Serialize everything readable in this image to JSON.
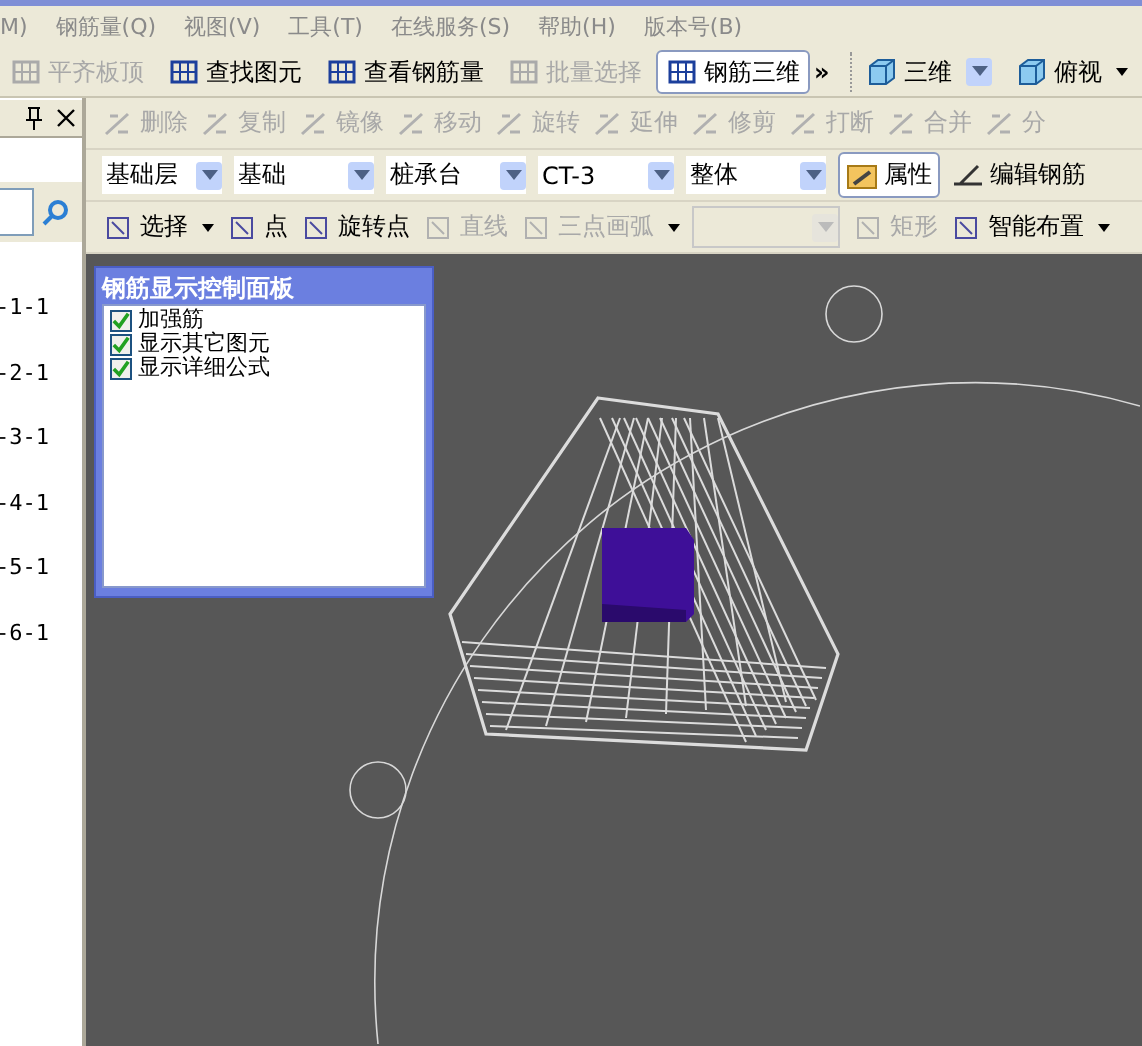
{
  "menu": [
    "M)",
    "钢筋量(Q)",
    "视图(V)",
    "工具(T)",
    "在线服务(S)",
    "帮助(H)",
    "版本号(B)"
  ],
  "main_toolbar": [
    {
      "label": "平齐板顶",
      "disabled": true,
      "selected": false
    },
    {
      "label": "查找图元",
      "disabled": false,
      "selected": false
    },
    {
      "label": "查看钢筋量",
      "disabled": false,
      "selected": false
    },
    {
      "label": "批量选择",
      "disabled": true,
      "selected": false
    },
    {
      "label": "钢筋三维",
      "disabled": false,
      "selected": true
    }
  ],
  "overflow": "»",
  "view_toolbar": [
    {
      "label": "三维",
      "kind": "combo"
    },
    {
      "label": "俯视",
      "kind": "menu"
    }
  ],
  "side_panel": {
    "list": [
      "-1-1",
      "-2-1",
      "-3-1",
      "-4-1",
      "-5-1",
      "-6-1"
    ]
  },
  "edit_toolbar": [
    {
      "label": "删除",
      "disabled": true
    },
    {
      "label": "复制",
      "disabled": true
    },
    {
      "label": "镜像",
      "disabled": true
    },
    {
      "label": "移动",
      "disabled": true
    },
    {
      "label": "旋转",
      "disabled": true
    },
    {
      "label": "延伸",
      "disabled": true
    },
    {
      "label": "修剪",
      "disabled": true
    },
    {
      "label": "打断",
      "disabled": true
    },
    {
      "label": "合并",
      "disabled": true
    },
    {
      "label": "分",
      "disabled": true
    }
  ],
  "selectors": [
    "基础层",
    "基础",
    "桩承台",
    "CT-3",
    "整体"
  ],
  "property_button": {
    "label": "属性",
    "selected": true
  },
  "edit_rebar": "编辑钢筋",
  "draw_toolbar": [
    {
      "label": "选择",
      "kind": "menu",
      "disabled": false
    },
    {
      "label": "点",
      "kind": "button",
      "disabled": false
    },
    {
      "label": "旋转点",
      "kind": "button",
      "disabled": false
    },
    {
      "label": "直线",
      "kind": "button",
      "disabled": true
    },
    {
      "label": "三点画弧",
      "kind": "menu",
      "disabled": true
    },
    {
      "kind": "combo",
      "disabled": true
    },
    {
      "label": "矩形",
      "kind": "button",
      "disabled": true
    },
    {
      "label": "智能布置",
      "kind": "menu",
      "disabled": false
    }
  ],
  "control_panel": {
    "title": "钢筋显示控制面板",
    "options": [
      {
        "label": "加强筋",
        "checked": true
      },
      {
        "label": "显示其它图元",
        "checked": true
      },
      {
        "label": "显示详细公式",
        "checked": true
      }
    ]
  }
}
